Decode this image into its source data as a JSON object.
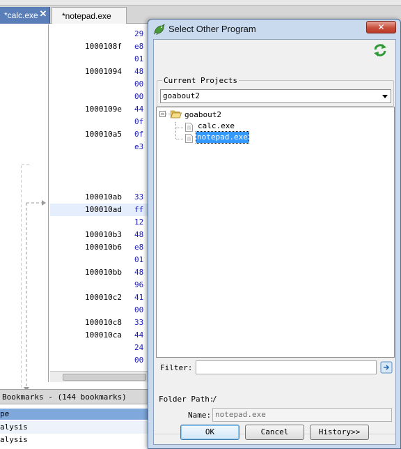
{
  "tabs": [
    {
      "label": "*calc.exe",
      "active": true
    },
    {
      "label": "*notepad.exe",
      "active": false
    }
  ],
  "listing": {
    "rows": [
      {
        "addr": "",
        "bytes": "29"
      },
      {
        "addr": "1000108f",
        "bytes": "e8"
      },
      {
        "addr": "",
        "bytes": "01"
      },
      {
        "addr": "10001094",
        "bytes": "48"
      },
      {
        "addr": "",
        "bytes": "00"
      },
      {
        "addr": "",
        "bytes": "00"
      },
      {
        "addr": "1000109e",
        "bytes": "44"
      },
      {
        "addr": "",
        "bytes": "0f"
      },
      {
        "addr": "100010a5",
        "bytes": "0f"
      },
      {
        "addr": "",
        "bytes": "e3"
      },
      {
        "addr": "",
        "bytes": ""
      },
      {
        "addr": "",
        "bytes": ""
      },
      {
        "addr": "",
        "bytes": ""
      },
      {
        "addr": "100010ab",
        "bytes": "33"
      },
      {
        "addr": "100010ad",
        "bytes": "ff"
      },
      {
        "addr": "",
        "bytes": "12"
      },
      {
        "addr": "100010b3",
        "bytes": "48"
      },
      {
        "addr": "100010b6",
        "bytes": "e8"
      },
      {
        "addr": "",
        "bytes": "01"
      },
      {
        "addr": "100010bb",
        "bytes": "48"
      },
      {
        "addr": "",
        "bytes": "96"
      },
      {
        "addr": "100010c2",
        "bytes": "41"
      },
      {
        "addr": "",
        "bytes": "00"
      },
      {
        "addr": "100010c8",
        "bytes": "33"
      },
      {
        "addr": "100010ca",
        "bytes": "44"
      },
      {
        "addr": "",
        "bytes": "24"
      },
      {
        "addr": "",
        "bytes": "00"
      }
    ]
  },
  "bookmarks": {
    "title": "Bookmarks - (144 bookmarks)",
    "column_header": "pe",
    "rows": [
      "alysis",
      "alysis"
    ]
  },
  "dialog": {
    "title": "Select Other Program",
    "close_label": "✕",
    "current_projects_label": "Current Projects",
    "selected_project": "goabout2",
    "tree": {
      "root": "goabout2",
      "children": [
        "calc.exe",
        "notepad.exe"
      ],
      "selected_index": 1
    },
    "filter_label": "Filter:",
    "filter_value": "",
    "folder_path_label": "Folder Path:",
    "folder_path_value": "/",
    "name_label": "Name:",
    "name_value": "notepad.exe",
    "ok_label": "OK",
    "cancel_label": "Cancel",
    "history_label": "History>>"
  },
  "colors": {
    "active_tab": "#5a7fb8",
    "selection": "#3399ff",
    "close_button": "#c9503c",
    "bytes_text": "#1a1ab8"
  }
}
